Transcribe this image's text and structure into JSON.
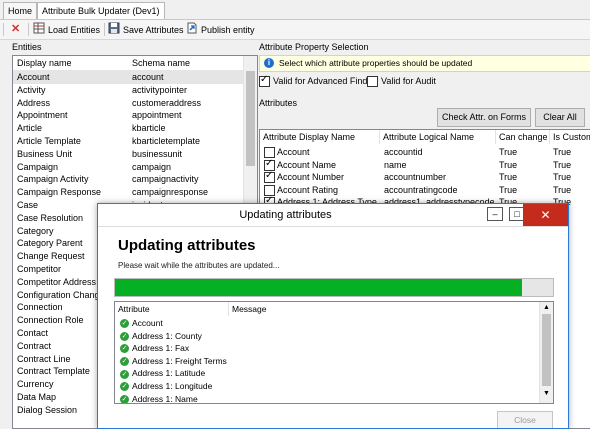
{
  "tabs": [
    {
      "label": "Home"
    },
    {
      "label": "Attribute Bulk Updater (Dev1)"
    }
  ],
  "toolbar": {
    "close_icon": "red-x-icon",
    "load_label": "Load Entities",
    "save_label": "Save Attributes",
    "publish_label": "Publish entity"
  },
  "entities": {
    "group_label": "Entities",
    "columns": [
      "Display name",
      "Schema name"
    ],
    "rows": [
      [
        "Account",
        "account"
      ],
      [
        "Activity",
        "activitypointer"
      ],
      [
        "Address",
        "customeraddress"
      ],
      [
        "Appointment",
        "appointment"
      ],
      [
        "Article",
        "kbarticle"
      ],
      [
        "Article Template",
        "kbarticletemplate"
      ],
      [
        "Business Unit",
        "businessunit"
      ],
      [
        "Campaign",
        "campaign"
      ],
      [
        "Campaign Activity",
        "campaignactivity"
      ],
      [
        "Campaign Response",
        "campaignresponse"
      ],
      [
        "Case",
        "incident"
      ],
      [
        "Case Resolution",
        ""
      ],
      [
        "Category",
        ""
      ],
      [
        "Category Parent",
        ""
      ],
      [
        "Change Request",
        ""
      ],
      [
        "Competitor",
        ""
      ],
      [
        "Competitor Address",
        ""
      ],
      [
        "Configuration Chang",
        ""
      ],
      [
        "Connection",
        ""
      ],
      [
        "Connection Role",
        ""
      ],
      [
        "Contact",
        ""
      ],
      [
        "Contract",
        ""
      ],
      [
        "Contract Line",
        ""
      ],
      [
        "Contract Template",
        ""
      ],
      [
        "Currency",
        ""
      ],
      [
        "Data Map",
        ""
      ],
      [
        "Dialog Session",
        ""
      ]
    ]
  },
  "attr_selection": {
    "group_label": "Attribute Property Selection",
    "info_text": "Select which attribute properties should be updated",
    "valid_adv_find_label": "Valid for Advanced Find",
    "valid_audit_label": "Valid for Audit"
  },
  "attributes": {
    "group_label": "Attributes",
    "check_forms_label": "Check Attr. on Forms",
    "clear_all_label": "Clear All",
    "columns": [
      "Attribute Display Name",
      "Attribute Logical Name",
      "Can change",
      "Is Customi"
    ],
    "rows": [
      {
        "checked": false,
        "display": "Account",
        "logical": "accountid",
        "can_change": "True",
        "is_custom": "True"
      },
      {
        "checked": true,
        "display": "Account Name",
        "logical": "name",
        "can_change": "True",
        "is_custom": "True"
      },
      {
        "checked": true,
        "display": "Account Number",
        "logical": "accountnumber",
        "can_change": "True",
        "is_custom": "True"
      },
      {
        "checked": false,
        "display": "Account Rating",
        "logical": "accountratingcode",
        "can_change": "True",
        "is_custom": "True"
      },
      {
        "checked": true,
        "display": "Address 1: Address Type",
        "logical": "address1_addresstypecode",
        "can_change": "True",
        "is_custom": "True"
      }
    ]
  },
  "dialog": {
    "title": "Updating attributes",
    "heading": "Updating attributes",
    "subtext": "Please wait while the attributes are updated...",
    "progress": 0.93,
    "columns": [
      "Attribute",
      "Message"
    ],
    "rows": [
      {
        "attribute": "Account",
        "message": ""
      },
      {
        "attribute": "Address 1: County",
        "message": ""
      },
      {
        "attribute": "Address 1: Fax",
        "message": ""
      },
      {
        "attribute": "Address 1: Freight Terms",
        "message": ""
      },
      {
        "attribute": "Address 1: Latitude",
        "message": ""
      },
      {
        "attribute": "Address 1: Longitude",
        "message": ""
      },
      {
        "attribute": "Address 1: Name",
        "message": ""
      }
    ],
    "close_label": "Close",
    "status_icon": "green-check-icon"
  }
}
